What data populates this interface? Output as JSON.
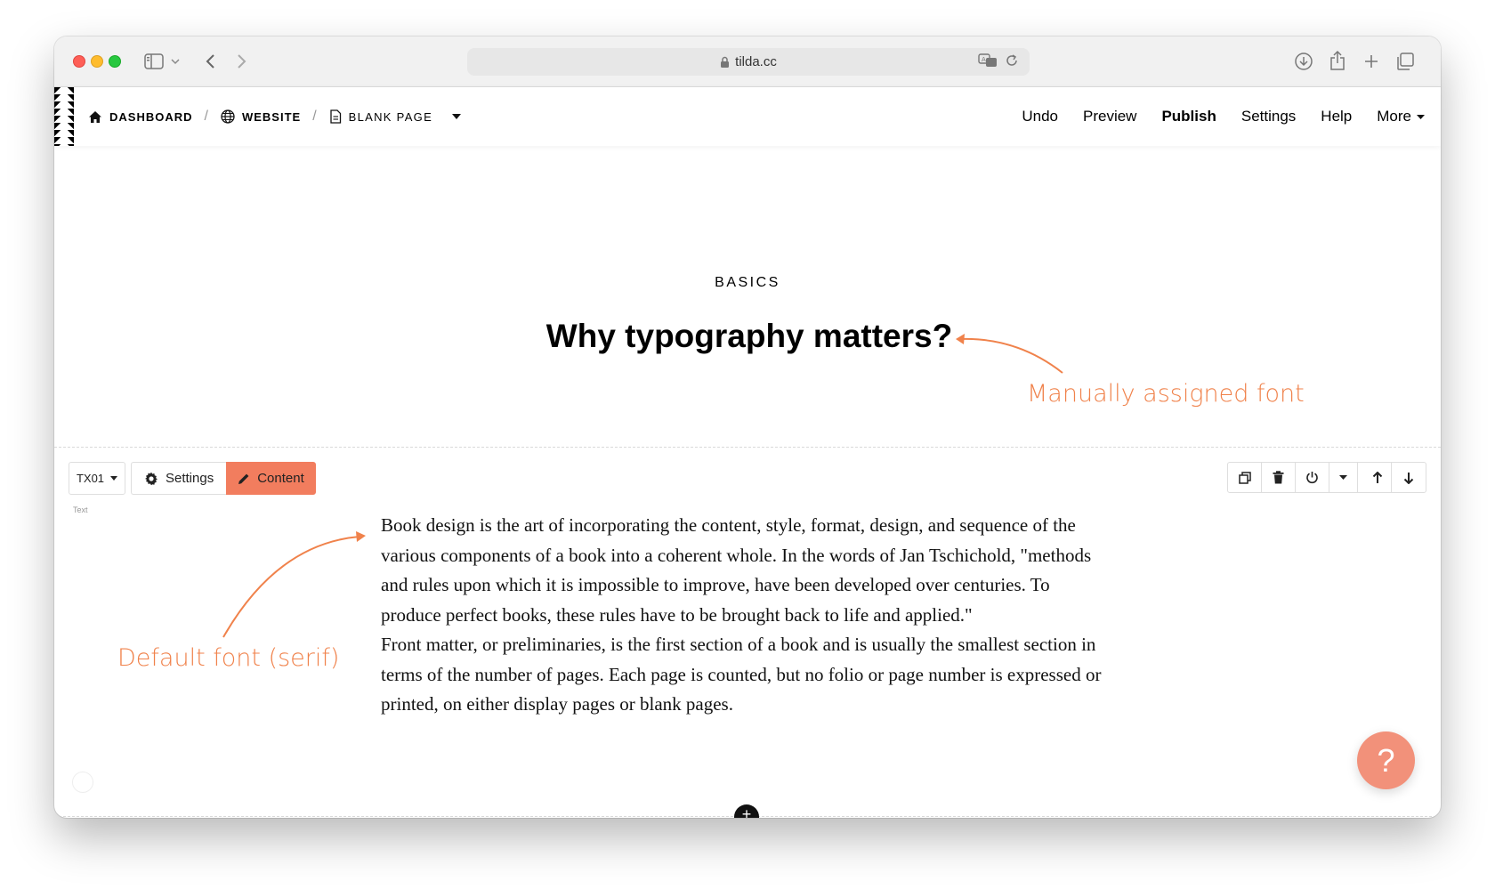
{
  "browser": {
    "url": "tilda.cc"
  },
  "breadcrumb": {
    "dashboard": "DASHBOARD",
    "website": "WEBSITE",
    "page": "BLANK PAGE"
  },
  "topnav": {
    "undo": "Undo",
    "preview": "Preview",
    "publish": "Publish",
    "settings": "Settings",
    "help": "Help",
    "more": "More"
  },
  "page": {
    "kicker": "BASICS",
    "headline": "Why typography matters?",
    "paragraph1": "Book design is the art of incorporating the content, style, format, design, and sequence of the various components of a book into a coherent whole. In the words of Jan Tschichold, \"methods and rules upon which it is impossible to improve, have been developed over centuries. To produce perfect books, these rules have to be brought back to life and applied.\"",
    "paragraph2": "Front matter, or preliminaries, is the first section of a book and is usually the smallest section in terms of the number of pages. Each page is counted, but no folio or page number is expressed or printed, on either display pages or blank pages."
  },
  "annotations": {
    "headline_note": "Manually assigned font",
    "body_note": "Default font (serif)",
    "color": "#f0824b"
  },
  "block_toolbar": {
    "code": "TX01",
    "settings": "Settings",
    "content": "Content",
    "block_type": "Text"
  },
  "help_button": {
    "label": "?"
  },
  "add_button": {
    "label": "+"
  },
  "colors": {
    "accent": "#f27d5e",
    "help": "#f2917a"
  }
}
